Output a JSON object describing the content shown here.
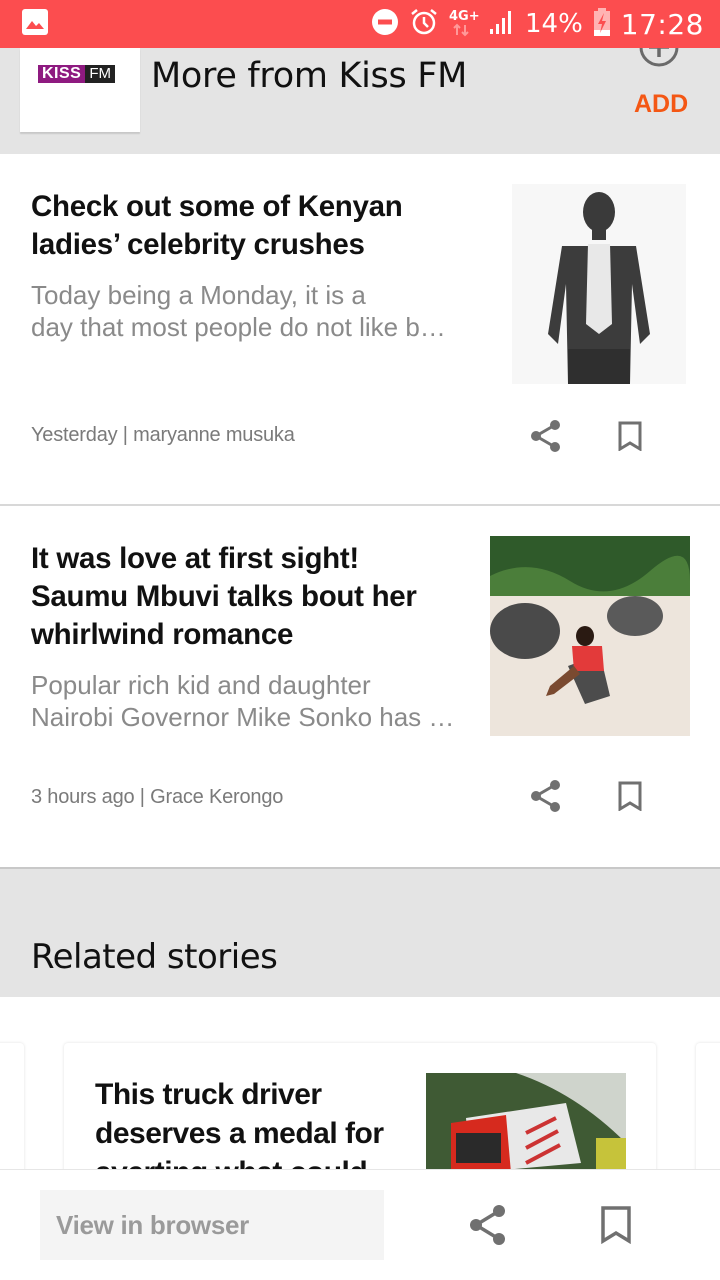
{
  "status_bar": {
    "left_icons": [
      "gallery-notification-icon"
    ],
    "right_icons": [
      "do-not-disturb-icon",
      "alarm-icon",
      "4g-plus-icon",
      "signal-icon",
      "battery-charging-icon"
    ],
    "network": "4G+",
    "battery_percent": "14%",
    "time": "17:28",
    "background_color": "#fc4d4f"
  },
  "source_header": {
    "logo": {
      "kiss": "KISS",
      "fm": "FM"
    },
    "title": "More from Kiss FM",
    "add_label": "ADD",
    "add_icon": "add-circle-icon",
    "accent_color": "#f45714"
  },
  "articles": [
    {
      "title_lines": [
        "Check out some of Kenyan",
        "ladies’ celebrity crushes"
      ],
      "snippet_lines": [
        "Today being a Monday, it is a",
        "day that most people do not like b…"
      ],
      "meta": "Yesterday | maryanne musuka",
      "thumbnail": "man-in-suit-photo",
      "actions": [
        "share-icon",
        "bookmark-icon"
      ]
    },
    {
      "title_lines": [
        "It was love at first sight!",
        "Saumu Mbuvi talks bout her",
        "whirlwind romance"
      ],
      "snippet_lines": [
        "Popular rich kid and daughter",
        "Nairobi Governor Mike Sonko has …"
      ],
      "meta": "3 hours ago | Grace Kerongo",
      "thumbnail": "woman-on-beach-rock-photo",
      "actions": [
        "share-icon",
        "bookmark-icon"
      ]
    }
  ],
  "related": {
    "heading": "Related stories",
    "cards": [
      {
        "title_lines": [
          "This truck driver",
          "deserves a medal for",
          "averting what could"
        ],
        "thumbnail": "red-truck-photo"
      }
    ]
  },
  "bottom_bar": {
    "view_in_browser": "View in browser",
    "icons": [
      "share-icon",
      "bookmark-icon"
    ]
  }
}
